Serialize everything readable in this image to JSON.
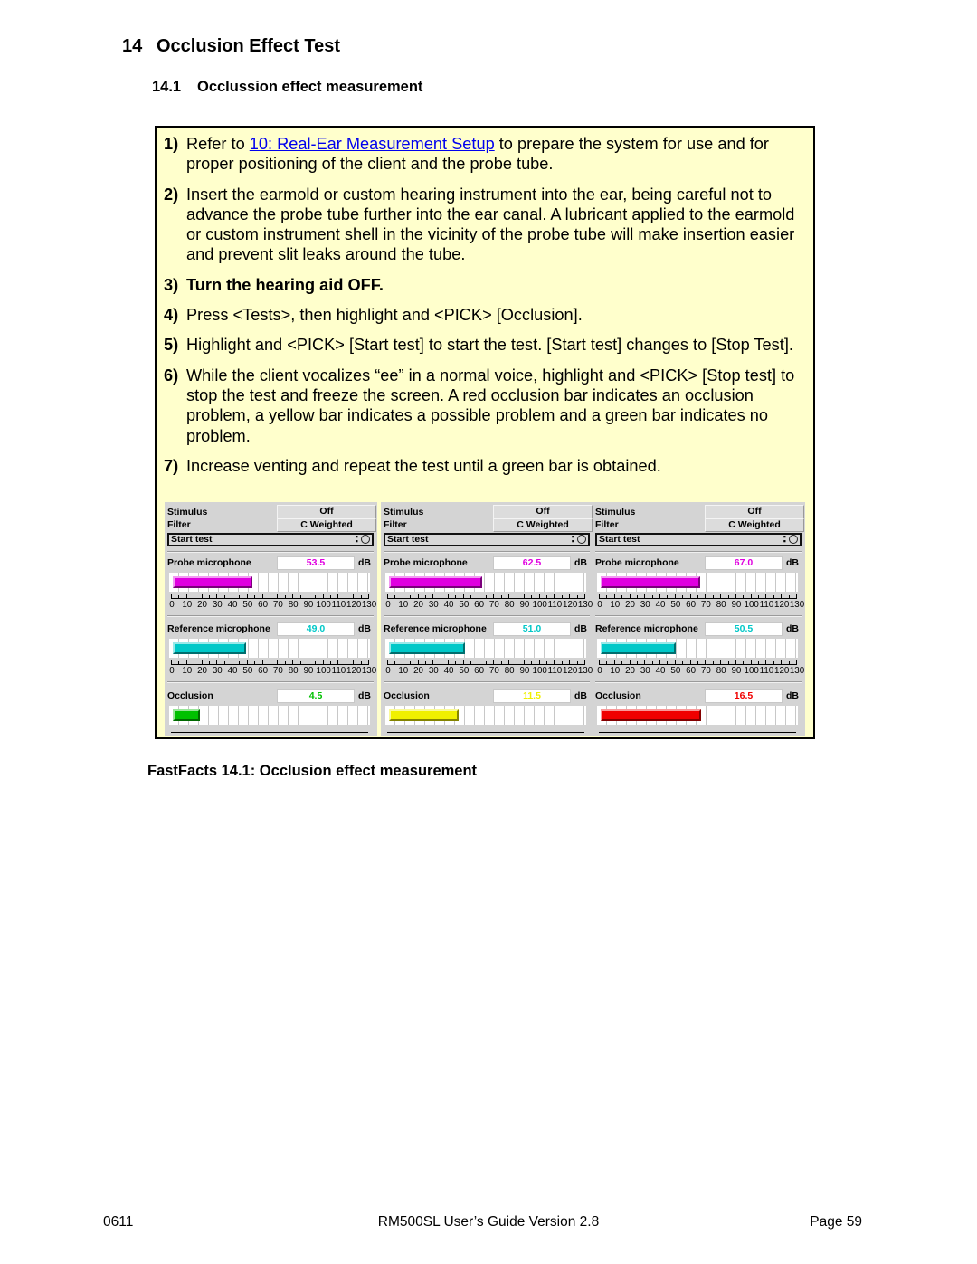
{
  "heading": {
    "number": "14",
    "title": "Occlusion Effect Test"
  },
  "subheading": {
    "number": "14.1",
    "title": "Occlussion effect measurement"
  },
  "steps": [
    {
      "n": "1)",
      "pre": "Refer to ",
      "link": "10: Real-Ear Measurement Setup",
      "post": " to prepare the system for use and for proper positioning of the client and the probe tube.",
      "bold": false
    },
    {
      "n": "2)",
      "text": "Insert the earmold or custom hearing instrument into the ear, being careful not to advance the probe tube further into the ear canal. A lubricant applied to the earmold or custom instrument shell in the vicinity of the probe tube will make insertion easier and prevent slit leaks around the tube.",
      "bold": false
    },
    {
      "n": "3)",
      "text": "Turn the hearing aid OFF.",
      "bold": true
    },
    {
      "n": "4)",
      "text": "Press <Tests>, then highlight and <PICK> [Occlusion].",
      "bold": false
    },
    {
      "n": "5)",
      "text": "Highlight and <PICK> [Start test] to start the test. [Start test] changes to [Stop Test].",
      "bold": false
    },
    {
      "n": "6)",
      "text": "While the client vocalizes “ee” in a normal voice, highlight and <PICK> [Stop test] to stop the test and freeze the screen. A red occlusion bar indicates an occlusion problem, a yellow bar indicates a possible problem and a green bar indicates no problem.",
      "bold": false
    },
    {
      "n": "7)",
      "text": "Increase venting and repeat the test until a green bar is obtained.",
      "bold": false
    }
  ],
  "panel_common": {
    "stimulus_label": "Stimulus",
    "stimulus_value": "Off",
    "filter_label": "Filter",
    "filter_value": "C Weighted",
    "start_button": "Start test",
    "probe_label": "Probe microphone",
    "reference_label": "Reference microphone",
    "occlusion_label": "Occlusion",
    "unit": "dB",
    "scale_labels": [
      "0",
      "10",
      "20",
      "30",
      "40",
      "50",
      "60",
      "70",
      "80",
      "90",
      "100",
      "110",
      "120",
      "130"
    ],
    "scale_max": 130
  },
  "colors": {
    "probe": "#e000e0",
    "reference": "#00c8c8",
    "occlusion_green": "#00c000",
    "occlusion_yellow": "#f0f000",
    "occlusion_red": "#f00000",
    "panel_bg": "#d4d4d4",
    "box_bg": "#ffffcc",
    "link": "#0000ee"
  },
  "panels": [
    {
      "probe": "53.5",
      "reference": "49.0",
      "occlusion": "4.5",
      "occlusion_status": "green",
      "occlusion_bar_fraction": 0.14
    },
    {
      "probe": "62.5",
      "reference": "51.0",
      "occlusion": "11.5",
      "occlusion_status": "yellow",
      "occlusion_bar_fraction": 0.36
    },
    {
      "probe": "67.0",
      "reference": "50.5",
      "occlusion": "16.5",
      "occlusion_status": "red",
      "occlusion_bar_fraction": 0.52
    }
  ],
  "caption": "FastFacts 14.1: Occlusion effect measurement",
  "footer": {
    "left": "0611",
    "center": "RM500SL User’s Guide Version 2.8",
    "right": "Page 59"
  }
}
